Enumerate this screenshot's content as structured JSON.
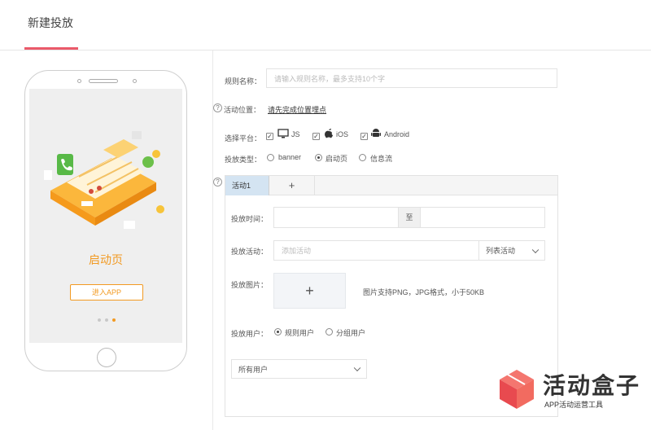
{
  "header": {
    "title": "新建投放"
  },
  "phone": {
    "splash_title": "启动页",
    "enter_button": "进入APP"
  },
  "form": {
    "rule_name_label": "规则名称：",
    "rule_name_placeholder": "请输入规则名称，最多支持10个字",
    "activity_position_label": "活动位置：",
    "activity_position_link": "请先完成位置埋点",
    "platform_label": "选择平台：",
    "platforms": [
      {
        "label": "JS",
        "checked": true
      },
      {
        "label": "iOS",
        "checked": true
      },
      {
        "label": "Android",
        "checked": true
      }
    ],
    "type_label": "投放类型：",
    "types": [
      {
        "label": "banner",
        "selected": false
      },
      {
        "label": "启动页",
        "selected": true
      },
      {
        "label": "信息流",
        "selected": false
      }
    ]
  },
  "panel": {
    "tabs": [
      {
        "label": "活动1"
      },
      {
        "label": "+"
      }
    ],
    "time_label": "投放时间：",
    "time_separator": "至",
    "activity_label": "投放活动：",
    "activity_placeholder": "添加活动",
    "activity_select": "列表活动",
    "image_label": "投放图片：",
    "upload_symbol": "+",
    "image_hint": "图片支持PNG，JPG格式，小于50KB",
    "user_label": "投放用户：",
    "user_options": [
      {
        "label": "规则用户",
        "selected": true
      },
      {
        "label": "分组用户",
        "selected": false
      }
    ],
    "user_select": "所有用户"
  },
  "brand": {
    "name": "活动盒子",
    "subtitle": "APP活动运营工具"
  },
  "colors": {
    "accent": "#ea5a6a",
    "orange": "#f29a22",
    "tab_active": "#d4e4f2"
  },
  "icons": [
    "help-icon",
    "monitor-icon",
    "apple-icon",
    "android-icon",
    "chevron-down-icon",
    "plus-icon"
  ]
}
